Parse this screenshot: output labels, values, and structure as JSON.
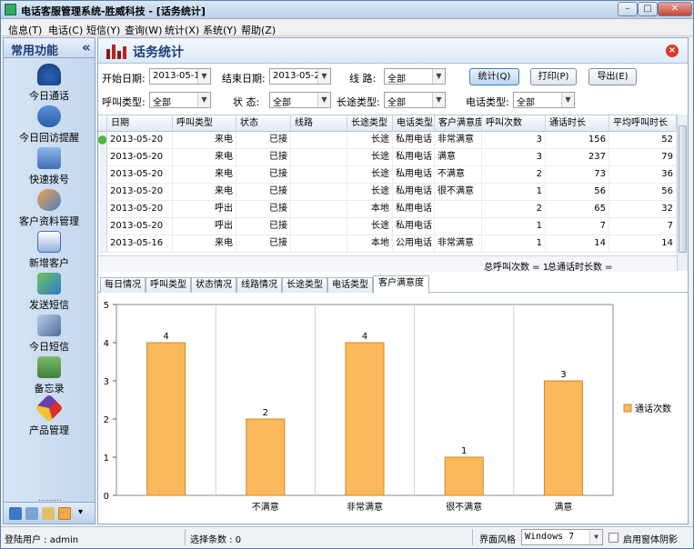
{
  "window": {
    "title": "电话客服管理系统-胜威科技 - [话务统计]"
  },
  "menu": [
    "信息(T)",
    "电话(C)",
    "短信(Y)",
    "查询(W)",
    "统计(X)",
    "系统(Y)",
    "帮助(Z)"
  ],
  "sidebar": {
    "title": "常用功能",
    "collapse": "«",
    "items": [
      {
        "label": "今日通话",
        "icon": "telephone-icon"
      },
      {
        "label": "今日回访提醒",
        "icon": "support-agent-icon"
      },
      {
        "label": "快速拨号",
        "icon": "speed-dial-icon"
      },
      {
        "label": "客户资料管理",
        "icon": "customers-icon"
      },
      {
        "label": "新增客户",
        "icon": "add-customer-icon"
      },
      {
        "label": "发送短信",
        "icon": "send-sms-icon"
      },
      {
        "label": "今日短信",
        "icon": "today-sms-icon"
      },
      {
        "label": "备忘录",
        "icon": "memo-icon"
      },
      {
        "label": "产品管理",
        "icon": "product-icon"
      }
    ],
    "dots": "........."
  },
  "page": {
    "title": "话务统计",
    "close": "×"
  },
  "filters": {
    "start_label": "开始日期:",
    "start_value": "2013-05-16",
    "end_label": "结束日期:",
    "end_value": "2013-05-20",
    "line_label": "线 路:",
    "line_value": "全部",
    "call_type_label": "呼叫类型:",
    "call_type_value": "全部",
    "status_label": "状 态:",
    "status_value": "全部",
    "long_type_label": "长途类型:",
    "long_type_value": "全部",
    "phone_type_label": "电话类型:",
    "phone_type_value": "全部"
  },
  "buttons": {
    "stat": "统计(Q)",
    "print": "打印(P)",
    "export": "导出(E)"
  },
  "table": {
    "columns": [
      "日期",
      "呼叫类型",
      "状态",
      "线路",
      "长途类型",
      "电话类型",
      "客户满意度",
      "呼叫次数",
      "通话时长",
      "平均呼叫时长"
    ],
    "rows": [
      [
        "2013-05-20",
        "来电",
        "已接",
        "",
        "长途",
        "私用电话",
        "非常满意",
        "3",
        "156",
        "52"
      ],
      [
        "2013-05-20",
        "来电",
        "已接",
        "",
        "长途",
        "私用电话",
        "满意",
        "3",
        "237",
        "79"
      ],
      [
        "2013-05-20",
        "来电",
        "已接",
        "",
        "长途",
        "私用电话",
        "不满意",
        "2",
        "73",
        "36"
      ],
      [
        "2013-05-20",
        "来电",
        "已接",
        "",
        "长途",
        "私用电话",
        "很不满意",
        "1",
        "56",
        "56"
      ],
      [
        "2013-05-20",
        "呼出",
        "已接",
        "",
        "本地",
        "私用电话",
        "",
        "2",
        "65",
        "32"
      ],
      [
        "2013-05-20",
        "呼出",
        "已接",
        "",
        "长途",
        "私用电话",
        "",
        "1",
        "7",
        "7"
      ],
      [
        "2013-05-16",
        "来电",
        "已接",
        "",
        "本地",
        "公用电话",
        "非常满意",
        "1",
        "14",
        "14"
      ]
    ],
    "summary_calls": "总呼叫次数 = 1",
    "summary_duration": "总通话时长数 ="
  },
  "tabs": [
    "每日情况",
    "呼叫类型",
    "状态情况",
    "线路情况",
    "长途类型",
    "电话类型",
    "客户满意度"
  ],
  "active_tab": 6,
  "chart_data": {
    "type": "bar",
    "categories": [
      "",
      "不满意",
      "非常满意",
      "很不满意",
      "满意"
    ],
    "series": [
      {
        "name": "通话次数",
        "values": [
          4,
          2,
          4,
          1,
          3
        ],
        "color": "#fbb95b"
      }
    ],
    "ylim": [
      0,
      5
    ],
    "yticks": [
      "0",
      "1",
      "2",
      "3",
      "4",
      "5"
    ],
    "legend": "right",
    "grid": "vertical-lines"
  },
  "status": {
    "user": "登陆用户 : admin",
    "selected": "选择条数 : 0",
    "style_label": "界面风格",
    "style_value": "Windows 7",
    "shadow_label": "启用窗体阴影"
  },
  "colors": {
    "bar": "#fbb95b",
    "bar_border": "#c98a2a",
    "accent": "#1c3d7a"
  }
}
